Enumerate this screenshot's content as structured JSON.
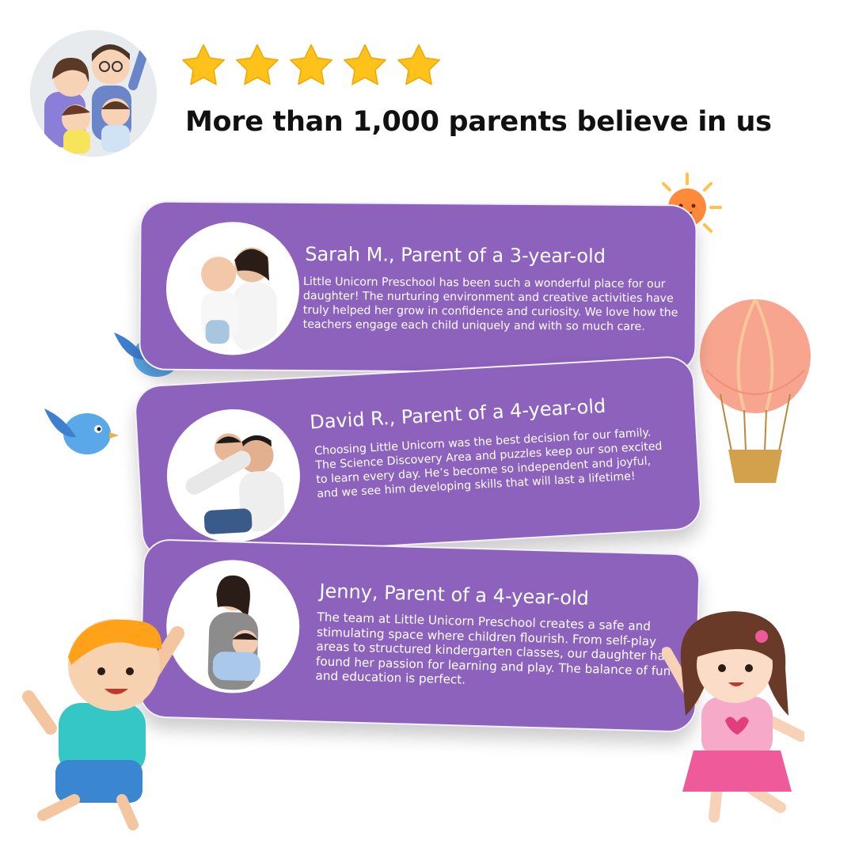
{
  "header": {
    "rating_stars": 5,
    "headline": "More than 1,000 parents believe in us"
  },
  "testimonials": [
    {
      "name": "Sarah M., Parent of a 3-year-old",
      "text": "Little Unicorn Preschool has been such a wonderful place for our daughter! The nurturing environment and creative activities have truly helped her grow in confidence and curiosity. We love how the teachers engage each child uniquely and with so much care."
    },
    {
      "name": "David R., Parent of a 4-year-old",
      "text": "Choosing Little Unicorn was the best decision for our family. The Science Discovery Area and puzzles keep our son excited to learn every day. He’s become so independent and joyful, and we see him developing skills that will last a lifetime!"
    },
    {
      "name": "Jenny, Parent of a 4-year-old",
      "text": "The team at Little Unicorn Preschool creates a safe and stimulating space where children flourish. From self-play areas to structured kindergarten classes, our daughter has found her passion for learning and play. The balance of fun and education is perfect."
    }
  ],
  "colors": {
    "card": "#8c62bc",
    "star": "#ffc21a",
    "headline": "#111111"
  }
}
